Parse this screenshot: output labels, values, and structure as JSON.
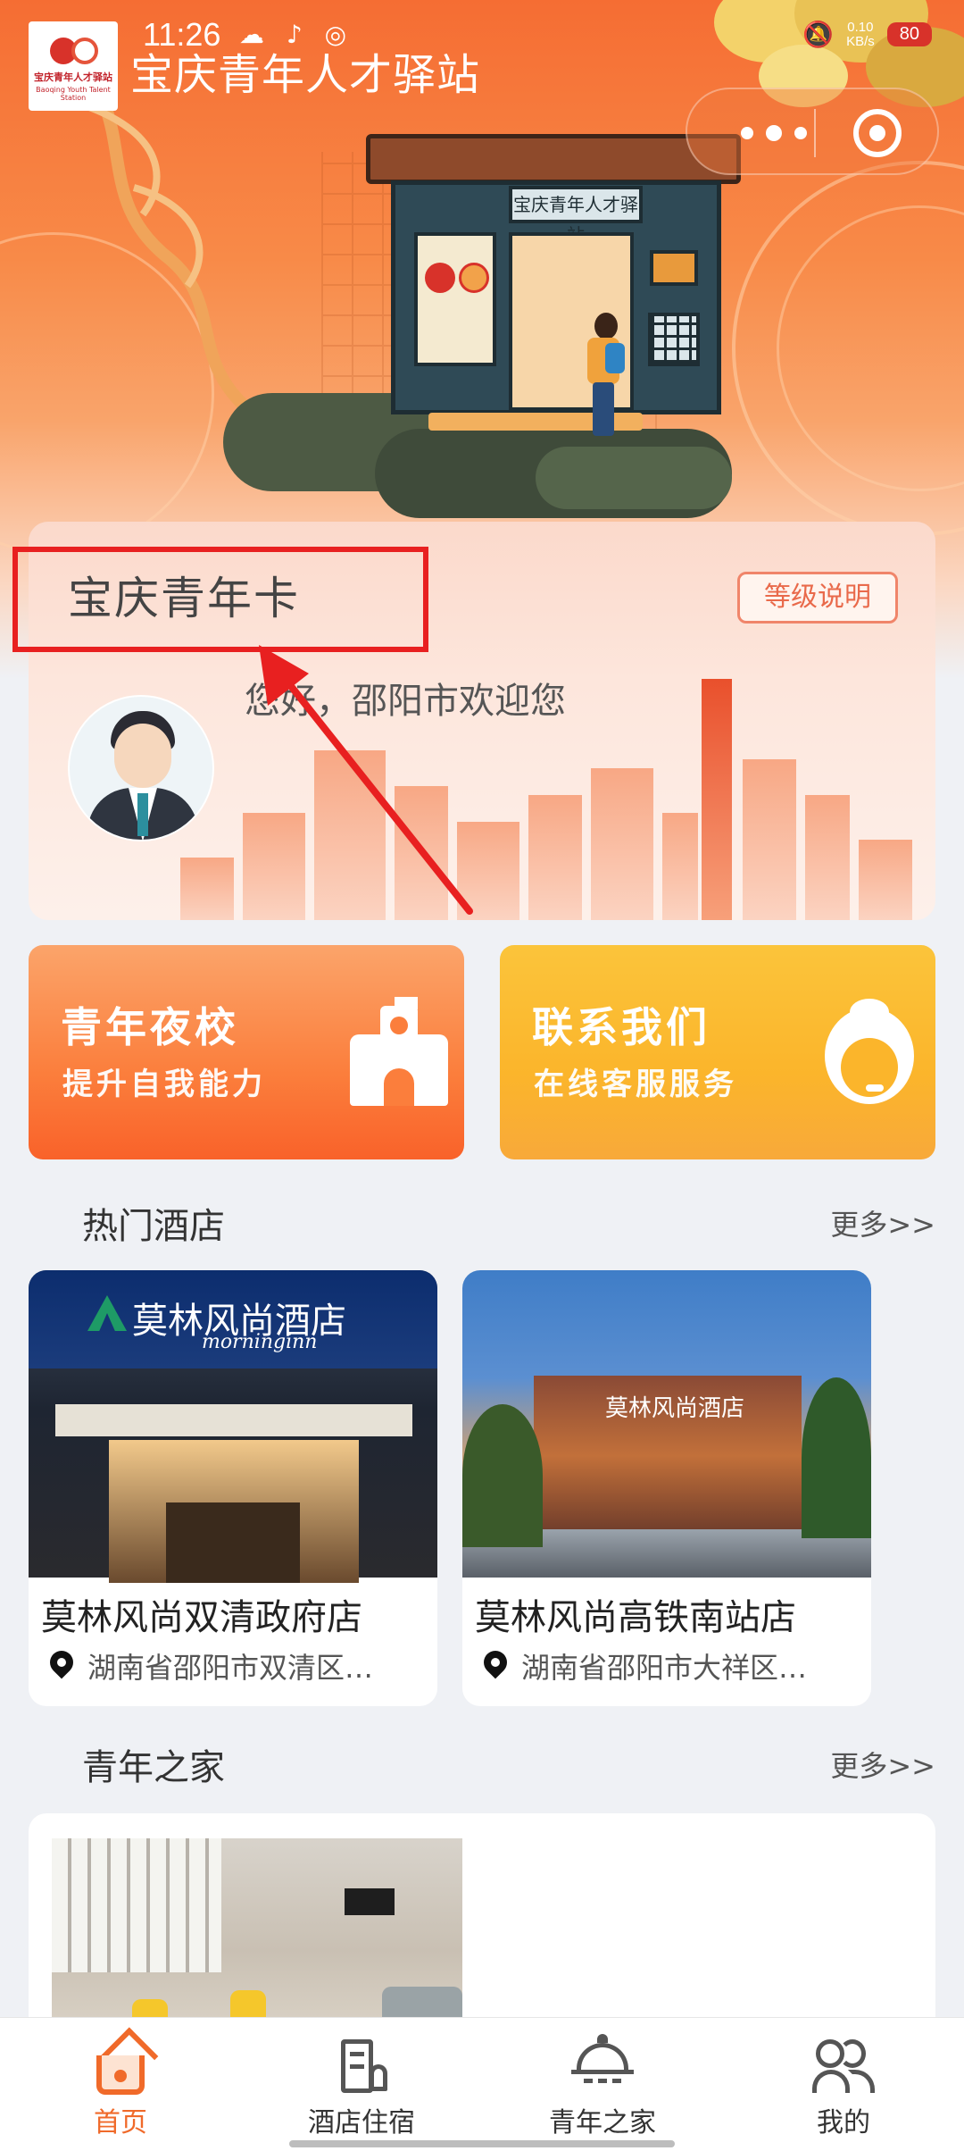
{
  "status_bar": {
    "time": "11:26",
    "net_speed": "0.10",
    "net_unit": "KB/s",
    "battery": "80"
  },
  "app": {
    "title": "宝庆青年人才驿站",
    "logo_text": "宝庆青年人才驿站",
    "logo_subtext": "Baoqing Youth Talent Station"
  },
  "hero": {
    "station_sign": "宝庆青年人才驿站"
  },
  "youth_card": {
    "title": "宝庆青年卡",
    "level_button": "等级说明",
    "greeting": "您好，邵阳市欢迎您"
  },
  "features": [
    {
      "title": "青年夜校",
      "subtitle": "提升自我能力",
      "icon": "school-icon",
      "color": "#fb7e3c"
    },
    {
      "title": "联系我们",
      "subtitle": "在线客服服务",
      "icon": "customer-service-icon",
      "color": "#fbb52b"
    }
  ],
  "hot_hotels": {
    "title": "热门酒店",
    "more": "更多>>",
    "items": [
      {
        "name": "莫林风尚双清政府店",
        "address": "湖南省邵阳市双清区…",
        "sign": "莫林风尚酒店",
        "sign_sub": "morninginn"
      },
      {
        "name": "莫林风尚高铁南站店",
        "address": "湖南省邵阳市大祥区…",
        "sign": "莫林风尚酒店"
      }
    ]
  },
  "youth_home": {
    "title": "青年之家",
    "more": "更多>>"
  },
  "tabbar": [
    {
      "label": "首页",
      "icon": "home-icon",
      "active": true
    },
    {
      "label": "酒店住宿",
      "icon": "hotel-icon",
      "active": false
    },
    {
      "label": "青年之家",
      "icon": "youth-home-icon",
      "active": false
    },
    {
      "label": "我的",
      "icon": "mine-icon",
      "active": false
    }
  ],
  "colors": {
    "brand_orange": "#f06a2a",
    "annotation_red": "#e82020"
  }
}
